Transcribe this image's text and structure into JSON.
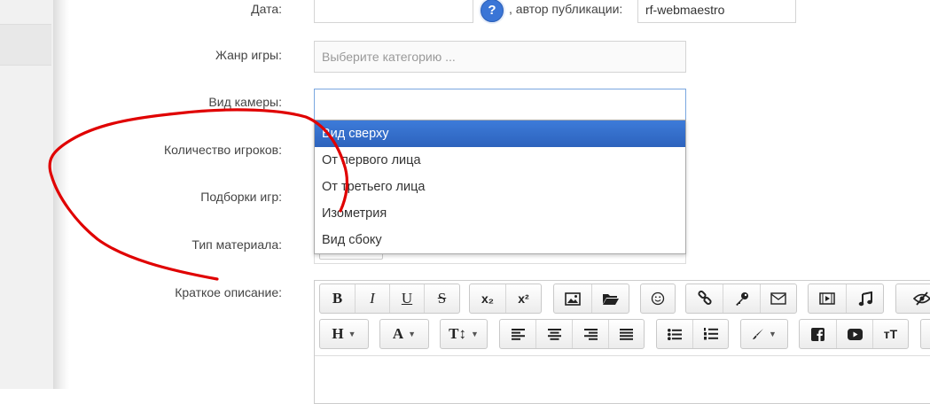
{
  "form": {
    "date_label": "Дата:",
    "author_prefix": ", автор публикации:",
    "author_value": "rf-webmaestro",
    "help_icon_glyph": "?",
    "genre_label": "Жанр игры:",
    "genre_placeholder": "Выберите категорию ...",
    "camera_label": "Вид камеры:",
    "players_label": "Количество игроков:",
    "collections_label": "Подборки игр:",
    "material_label": "Тип материала:",
    "short_desc_label": "Краткое описание:"
  },
  "camera_dropdown": {
    "options": [
      "Вид сверху",
      "От первого лица",
      "От третьего лица",
      "Изометрия",
      "Вид сбоку"
    ],
    "selected_index": 0
  },
  "toolbar": {
    "bold": "B",
    "italic": "I",
    "underline": "U",
    "strike": "S",
    "subscript": "x₂",
    "superscript": "x²",
    "heading": "H",
    "font": "A",
    "font_size": "T↕",
    "text_size": "тT"
  },
  "icons": {
    "image": "image-icon",
    "folder": "folder-icon",
    "smile": "smile-icon",
    "link": "link-icon",
    "key": "key-icon",
    "mail": "mail-icon",
    "video": "video-icon",
    "music": "music-icon",
    "hide": "eye-slash-icon",
    "facebook": "facebook-icon",
    "youtube": "youtube-icon",
    "brush": "brush-icon"
  },
  "colors": {
    "selected_option": "#2d63bd",
    "help_icon": "#3a75d6",
    "annotation": "#e00000"
  }
}
